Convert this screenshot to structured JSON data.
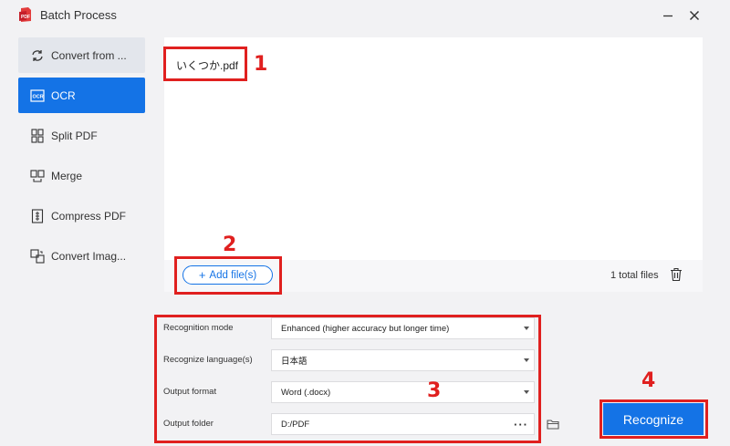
{
  "window": {
    "title": "Batch Process",
    "minimize_icon": "minimize-icon",
    "close_icon": "close-icon"
  },
  "sidebar": {
    "items": [
      {
        "label": "Convert from ...",
        "icon": "convert-icon",
        "state": "hover"
      },
      {
        "label": "OCR",
        "icon": "ocr-icon",
        "state": "active"
      },
      {
        "label": "Split PDF",
        "icon": "split-icon",
        "state": "normal"
      },
      {
        "label": "Merge",
        "icon": "merge-icon",
        "state": "normal"
      },
      {
        "label": "Compress PDF",
        "icon": "compress-icon",
        "state": "normal"
      },
      {
        "label": "Convert Imag...",
        "icon": "convert-image-icon",
        "state": "normal"
      }
    ]
  },
  "files": {
    "items": [
      "いくつか.pdf"
    ],
    "add_label": "Add file(s)",
    "total_label": "1 total files"
  },
  "settings": {
    "recognition_mode": {
      "label": "Recognition mode",
      "value": "Enhanced (higher accuracy but longer time)"
    },
    "language": {
      "label": "Recognize language(s)",
      "value": "日本語"
    },
    "output_format": {
      "label": "Output format",
      "value": "Word (.docx)"
    },
    "output_folder": {
      "label": "Output folder",
      "value": "D:/PDF",
      "browse": "···"
    }
  },
  "actions": {
    "recognize_label": "Recognize"
  },
  "annotations": {
    "n1": "1",
    "n2": "2",
    "n3": "3",
    "n4": "4"
  },
  "colors": {
    "accent": "#1473e6",
    "highlight": "#e0201f",
    "background": "#f2f2f4"
  }
}
